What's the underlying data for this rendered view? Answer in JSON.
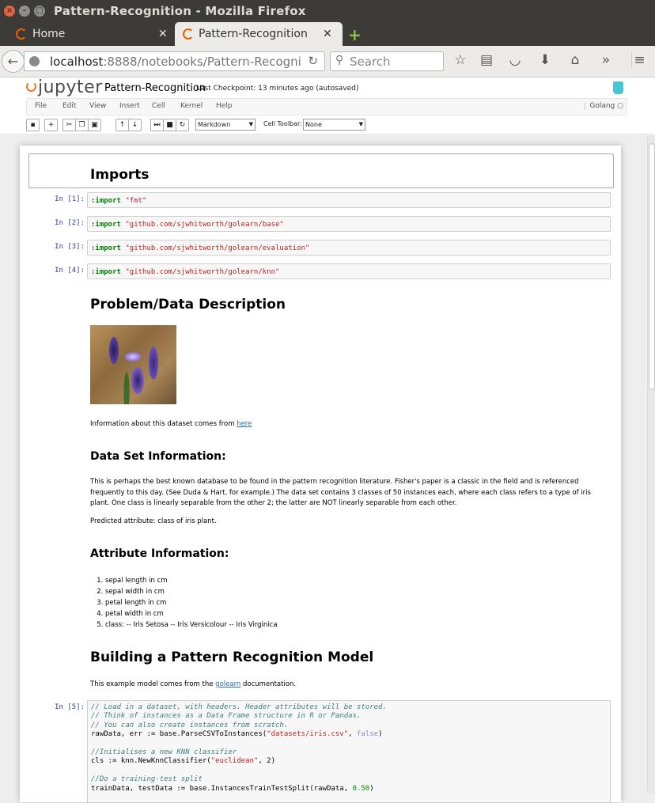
{
  "window": {
    "title": "Pattern-Recognition - Mozilla Firefox"
  },
  "tabs": [
    {
      "label": "Home"
    },
    {
      "label": "Pattern-Recognition"
    }
  ],
  "navbar": {
    "url_host": "localhost",
    "url_path": ":8888/notebooks/Pattern-Recogni",
    "search_placeholder": "Search"
  },
  "jupyter": {
    "logo_text": "jupyter",
    "notebook_name": "Pattern-Recognition",
    "checkpoint": "Last Checkpoint: 13 minutes ago (autosaved)",
    "menus": [
      "File",
      "Edit",
      "View",
      "Insert",
      "Cell",
      "Kernel",
      "Help"
    ],
    "kernel_name": "Golang",
    "toolbar": {
      "cell_type": "Markdown",
      "cell_toolbar_label": "Cell Toolbar:",
      "cell_toolbar_value": "None"
    }
  },
  "notebook": {
    "imports_heading": "Imports",
    "import_cells": [
      {
        "prompt": "In [1]:",
        "kw": ":import",
        "path": "\"fmt\""
      },
      {
        "prompt": "In [2]:",
        "kw": ":import",
        "path": "\"github.com/sjwhitworth/golearn/base\""
      },
      {
        "prompt": "In [3]:",
        "kw": ":import",
        "path": "\"github.com/sjwhitworth/golearn/evaluation\""
      },
      {
        "prompt": "In [4]:",
        "kw": ":import",
        "path": "\"github.com/sjwhitworth/golearn/knn\""
      }
    ],
    "problem_heading": "Problem/Data Description",
    "info_text": "Information about this dataset comes from ",
    "info_link": "here",
    "dataset_heading": "Data Set Information:",
    "dataset_text": "This is perhaps the best known database to be found in the pattern recognition literature. Fisher's paper is a classic in the field and is referenced frequently to this day. (See Duda & Hart, for example.) The data set contains 3 classes of 50 instances each, where each class refers to a type of iris plant. One class is linearly separable from the other 2; the latter are NOT linearly separable from each other.",
    "predicted_text": "Predicted attribute: class of iris plant.",
    "attr_heading": "Attribute Information:",
    "attributes": [
      "sepal length in cm",
      "sepal width in cm",
      "petal length in cm",
      "petal width in cm",
      "class: -- Iris Setosa -- Iris Versicolour -- Iris Virginica"
    ],
    "model_heading": "Building a Pattern Recognition Model",
    "model_text_before": "This example model comes from the ",
    "model_link": "golearn",
    "model_text_after": " documentation.",
    "cell5_prompt": "In [5]:",
    "cell5_lines": {
      "l1": "// Load in a dataset, with headers. Header attributes will be stored.",
      "l2": "// Think of instances as a Data Frame structure in R or Pandas.",
      "l3": "// You can also create instances from scratch.",
      "l4a": "rawData, err := base.ParseCSVToInstances(",
      "l4s": "\"datasets/iris.csv\"",
      "l4c": ", ",
      "l4b": "false",
      "l4e": ")",
      "l6": "//Initialises a new KNN classifier",
      "l7a": "cls := knn.NewKnnClassifier(",
      "l7s": "\"euclidean\"",
      "l7e": ", 2)",
      "l9": "//Do a training-test split",
      "l10a": "trainData, testData := base.InstancesTrainTestSplit(rawData, ",
      "l10n": "0.50",
      "l10e": ")"
    }
  }
}
